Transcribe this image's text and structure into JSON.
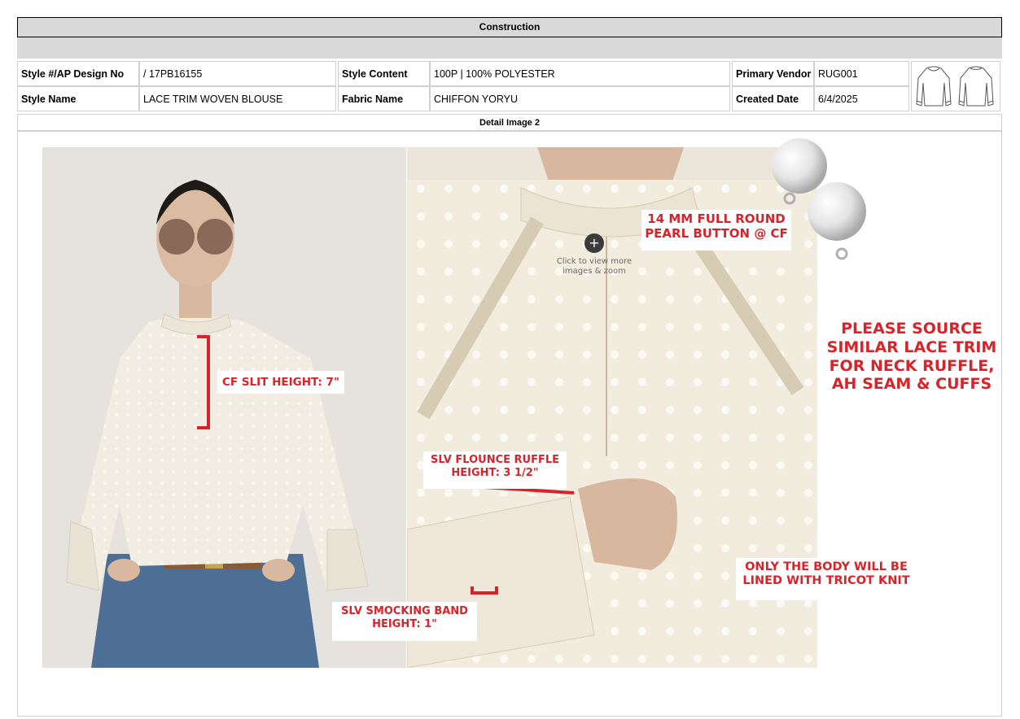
{
  "header": {
    "section_title": "Construction",
    "detail_title": "Detail Image 2"
  },
  "info": {
    "style_no_label": "Style #/AP Design No",
    "style_no_value": "/ 17PB16155",
    "style_name_label": "Style Name",
    "style_name_value": "LACE TRIM WOVEN BLOUSE",
    "style_content_label": "Style Content",
    "style_content_value": "100P   | 100% POLYESTER",
    "fabric_name_label": "Fabric Name",
    "fabric_name_value": "CHIFFON YORYU",
    "vendor_label": "Primary Vendor",
    "vendor_value": "RUG001",
    "created_label": "Created Date",
    "created_value": "6/4/2025"
  },
  "callouts": {
    "cf_slit": "CF SLIT HEIGHT: 7\"",
    "button_line1": "14 MM FULL ROUND",
    "button_line2": "PEARL BUTTON @ CF",
    "zoom_line1": "Click to view more",
    "zoom_line2": "images & zoom",
    "source_line1": "PLEASE SOURCE",
    "source_line2": "SIMILAR LACE TRIM",
    "source_line3": "FOR NECK RUFFLE,",
    "source_line4": "AH SEAM & CUFFS",
    "flounce_line1": "SLV FLOUNCE RUFFLE",
    "flounce_line2": "HEIGHT: 3 1/2\"",
    "smocking_line1": "SLV SMOCKING BAND",
    "smocking_line2": "HEIGHT: 1\"",
    "lining_line1": "ONLY THE BODY WILL BE",
    "lining_line2": "LINED WITH TRICOT KNIT"
  },
  "colors": {
    "accent_red": "#d9232a",
    "header_gray": "#d9d9d9"
  }
}
